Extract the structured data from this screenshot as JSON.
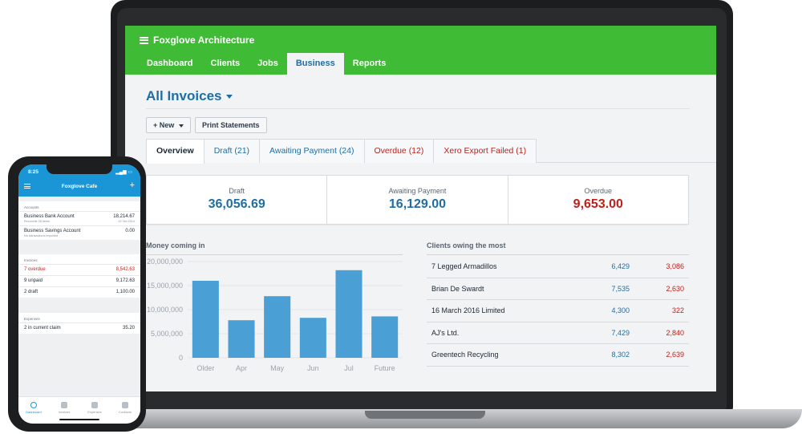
{
  "laptop": {
    "org_name": "Foxglove Architecture",
    "nav": [
      "Dashboard",
      "Clients",
      "Jobs",
      "Business",
      "Reports"
    ],
    "page_title": "All Invoices",
    "buttons": {
      "new": "+ New",
      "print": "Print Statements"
    },
    "tabs": [
      {
        "label": "Overview"
      },
      {
        "label": "Draft (21)"
      },
      {
        "label": "Awaiting Payment (24)"
      },
      {
        "label": "Overdue (12)"
      },
      {
        "label": "Xero Export Failed (1)"
      }
    ],
    "summary": [
      {
        "label": "Draft",
        "value": "36,056.69"
      },
      {
        "label": "Awaiting Payment",
        "value": "16,129.00"
      },
      {
        "label": "Overdue",
        "value": "9,653.00"
      }
    ],
    "money_title": "Money coming in",
    "clients_title": "Clients owing the most",
    "clients": [
      {
        "name": "7 Legged Armadillos",
        "amount": "6,429",
        "overdue": "3,086"
      },
      {
        "name": "Brian De Swardt",
        "amount": "7,535",
        "overdue": "2,630"
      },
      {
        "name": "16 March 2016 Limited",
        "amount": "4,300",
        "overdue": "322"
      },
      {
        "name": "AJ's Ltd.",
        "amount": "7,429",
        "overdue": "2,840"
      },
      {
        "name": "Greentech Recycling",
        "amount": "8,302",
        "overdue": "2,639"
      }
    ]
  },
  "chart_data": {
    "type": "bar",
    "title": "Money coming in",
    "categories": [
      "Older",
      "Apr",
      "May",
      "Jun",
      "Jul",
      "Future"
    ],
    "values": [
      16000000,
      7800000,
      12800000,
      8300000,
      18200000,
      8600000
    ],
    "yticks": [
      "20,000,000",
      "15,000,000",
      "10,000,000",
      "5,000,000",
      "0"
    ],
    "ylim": [
      0,
      20000000
    ],
    "grid": true,
    "bar_color": "#4a9fd5"
  },
  "phone": {
    "time": "8:25",
    "title": "Foxglove Cafe",
    "accounts_title": "Accounts",
    "accounts": [
      {
        "name": "Business Bank Account",
        "sub": "Reconcile 28 items",
        "amount": "18,214.67",
        "date": "22 Oct 2014"
      },
      {
        "name": "Business Savings Account",
        "sub": "No transactions imported",
        "amount": "0.00",
        "date": ""
      }
    ],
    "invoices_title": "Invoices",
    "invoices": [
      {
        "label": "7 overdue",
        "amount": "8,542.63"
      },
      {
        "label": "9 unpaid",
        "amount": "9,172.63"
      },
      {
        "label": "2 draft",
        "amount": "1,100.00"
      }
    ],
    "expenses_title": "Expenses",
    "expenses": [
      {
        "label": "2 in current claim",
        "amount": "35.20"
      }
    ],
    "tabbar": [
      "Dashboard",
      "Invoices",
      "Expenses",
      "Contacts"
    ]
  },
  "colors": {
    "brand_green": "#3fbb36",
    "link_blue": "#1f6ea3",
    "overdue_red": "#c0201b",
    "phone_blue": "#1a96d6"
  }
}
